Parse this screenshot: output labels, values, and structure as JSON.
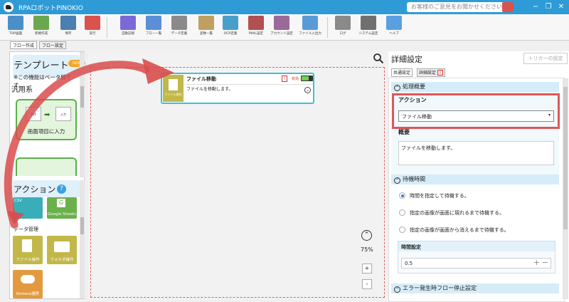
{
  "window": {
    "title": "RPAロボットPINOKIO",
    "feedback": "お客様のご意見をお聞かせください",
    "minimize": "−",
    "restore": "❐",
    "close": "✕"
  },
  "toolbar": [
    {
      "label": "TOP画面",
      "icon": "home-grid-icon",
      "color": "#4a90c8"
    },
    {
      "label": "新規作成",
      "icon": "new-flow-icon",
      "color": "#6aa84f"
    },
    {
      "label": "保存",
      "icon": "save-icon",
      "color": "#4a7fb0"
    },
    {
      "label": "実行",
      "icon": "run-icon",
      "color": "#d9534f"
    },
    {
      "label": "自動記録",
      "icon": "record-icon",
      "color": "#7a6ad8"
    },
    {
      "label": "フロー一覧",
      "icon": "flow-list-icon",
      "color": "#5c8fd6"
    },
    {
      "label": "データ定義",
      "icon": "data-def-icon",
      "color": "#8a8a8a"
    },
    {
      "label": "変数一覧",
      "icon": "variables-icon",
      "color": "#c0a060"
    },
    {
      "label": "OCR定義",
      "icon": "ocr-icon",
      "color": "#4a9fc8"
    },
    {
      "label": "MAIL設定",
      "icon": "mail-icon",
      "color": "#b05050"
    },
    {
      "label": "アカウント設定",
      "icon": "account-icon",
      "color": "#9a6a9a"
    },
    {
      "label": "ファイル入出力",
      "icon": "file-io-icon",
      "color": "#5a9ad6"
    },
    {
      "label": "ログ",
      "icon": "log-icon",
      "color": "#8a8a8a"
    },
    {
      "label": "システム設定",
      "icon": "gear-icon",
      "color": "#707070"
    },
    {
      "label": "ヘルプ",
      "icon": "help-icon",
      "color": "#5aa0e0"
    }
  ],
  "tabs": {
    "flow_create": "フロー作成",
    "flow_settings": "フロー設定"
  },
  "templates": {
    "title": "テンプレート",
    "badge": "NEW",
    "note": "※この機能はベータ版です。",
    "group": "汎用系",
    "card1_label": "画面項目に入力",
    "card1_src": "PDF",
    "card1_dst": "入力"
  },
  "actions": {
    "title": "アクション",
    "help": "?",
    "top_cards": [
      "CSV",
      "Google Sheets"
    ],
    "group": "データ管理",
    "cards": [
      "ファイル操作",
      "フォルダ操作",
      "Kintone連携"
    ]
  },
  "canvas": {
    "node": {
      "title": "ファイル移動",
      "desc": "ファイルを移動します。",
      "enabled": "有効",
      "warn": "!",
      "icon_label": "ファイル操作"
    },
    "zoom": "75%",
    "plus": "+",
    "minus": "-"
  },
  "detail": {
    "title": "詳細設定",
    "trigger": "トリガーの設定",
    "tab_common": "共通設定",
    "tab_detail": "詳細設定",
    "sec1": "処理概要",
    "action_label": "アクション",
    "action_value": "ファイル移動",
    "summary_label": "概要",
    "summary_value": "ファイルを移動します。",
    "sec2": "待機時間",
    "radios": [
      "時間を指定して待機する。",
      "指定の画像が画面に現れるまで待機する。",
      "指定の画像が画面から消えるまで待機する。"
    ],
    "radio_selected": 0,
    "time_label": "時間設定",
    "time_value": "0.5",
    "sec3": "エラー発生時フロー停止設定"
  },
  "colors": {
    "accent": "#2e9bd6",
    "highlight": "#e05757",
    "node_border": "#3ec1d3"
  }
}
